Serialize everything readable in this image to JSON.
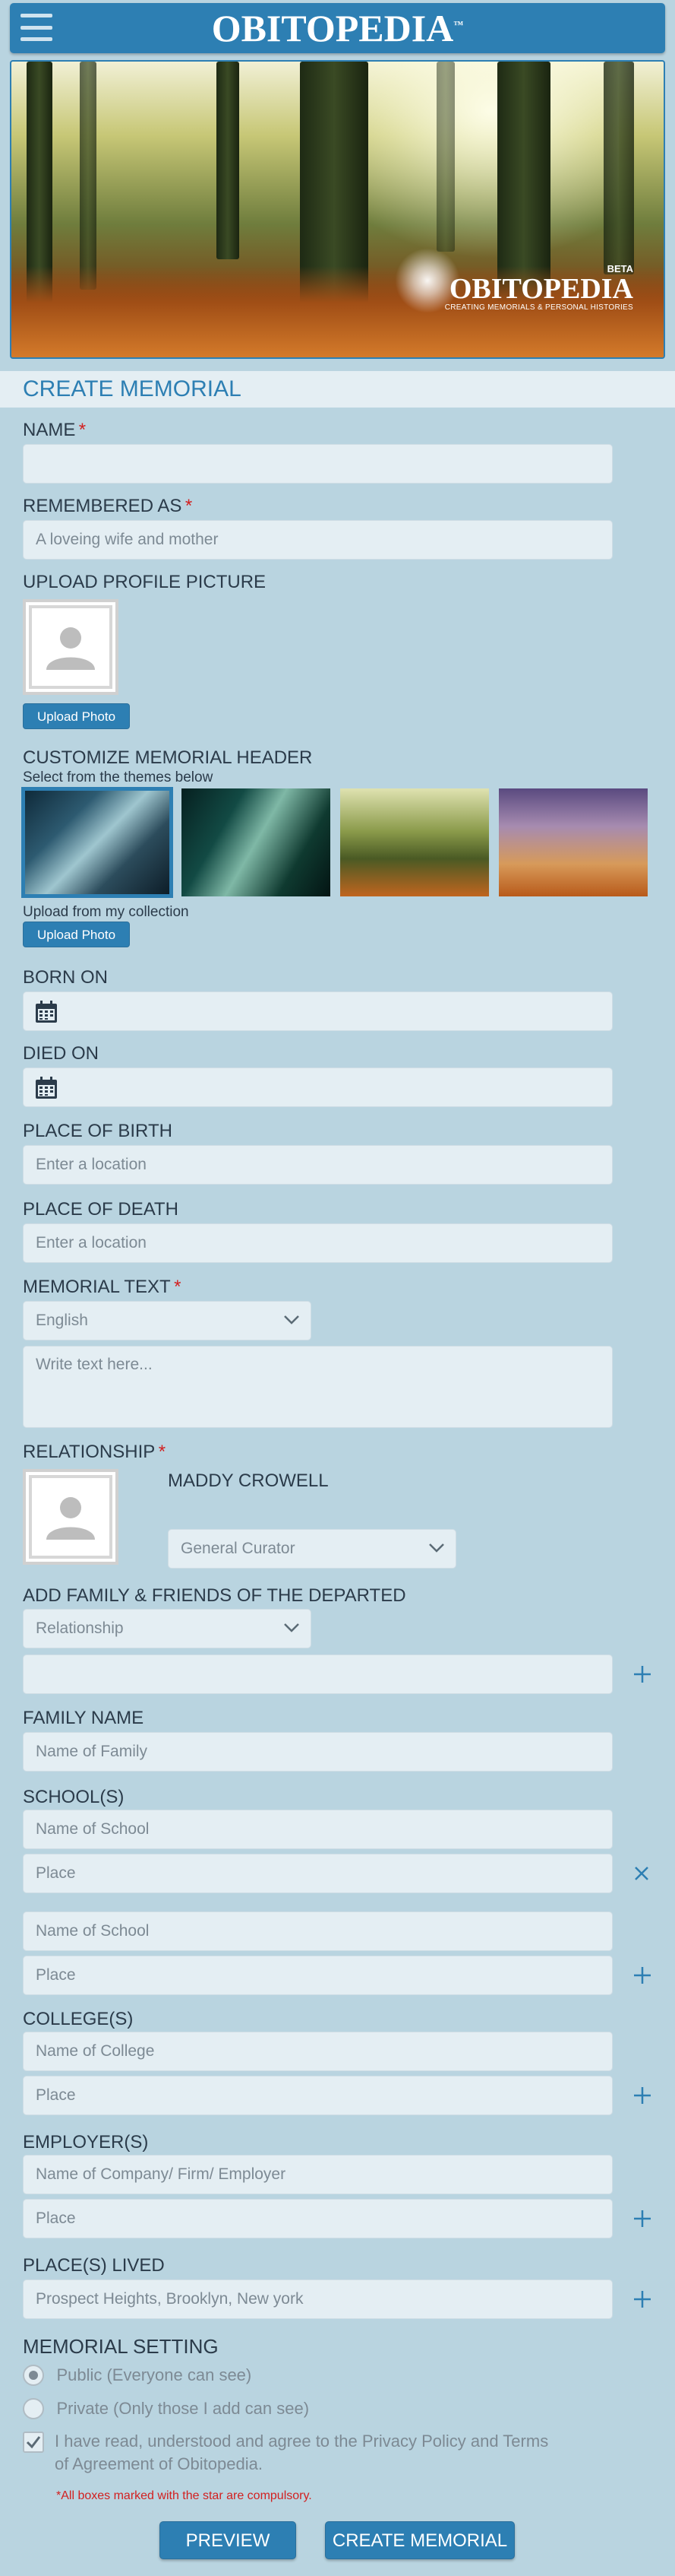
{
  "header": {
    "logo_text": "OBITOPEDIA",
    "logo_tm": "™",
    "menu_icon": "hamburger-menu-icon"
  },
  "hero": {
    "beta": "BETA",
    "brand": "OBITOPEDIA",
    "tagline": "CREATING MEMORIALS & PERSONAL HISTORIES"
  },
  "page_title": "CREATE MEMORIAL",
  "fields": {
    "name": {
      "label": "NAME",
      "required": "*",
      "value": ""
    },
    "remembered_as": {
      "label": "REMEMBERED AS",
      "required": "*",
      "placeholder": "A loveing wife and mother"
    },
    "upload_profile": {
      "label": "UPLOAD PROFILE PICTURE",
      "button": "Upload Photo"
    },
    "header_theme": {
      "label": "CUSTOMIZE MEMORIAL HEADER",
      "hint": "Select from the themes below",
      "collection_hint": "Upload from my collection",
      "button": "Upload Photo"
    },
    "born_on": {
      "label": "BORN ON"
    },
    "died_on": {
      "label": "DIED ON"
    },
    "place_of_birth": {
      "label": "PLACE OF BIRTH",
      "placeholder": "Enter a location"
    },
    "place_of_death": {
      "label": "PLACE OF DEATH",
      "placeholder": "Enter a location"
    },
    "memorial_text": {
      "label": "MEMORIAL TEXT",
      "required": "*",
      "language": "English",
      "placeholder": "Write text here..."
    },
    "relationship": {
      "label": "RELATIONSHIP",
      "required": "*",
      "person": "MADDY CROWELL",
      "role": "General Curator"
    },
    "family_friends": {
      "label": "ADD FAMILY & FRIENDS OF THE DEPARTED",
      "select": "Relationship"
    },
    "family_name": {
      "label": "FAMILY NAME",
      "placeholder": "Name of Family"
    },
    "schools": {
      "label": "SCHOOL(S)",
      "name_placeholder": "Name of School",
      "place_placeholder": "Place"
    },
    "colleges": {
      "label": "COLLEGE(S)",
      "name_placeholder": "Name of College",
      "place_placeholder": "Place"
    },
    "employers": {
      "label": "EMPLOYER(S)",
      "name_placeholder": "Name of Company/ Firm/ Employer",
      "place_placeholder": "Place"
    },
    "places_lived": {
      "label": "PLACE(S) LIVED",
      "value": "Prospect Heights, Brooklyn, New york"
    }
  },
  "memorial_setting": {
    "label": "MEMORIAL SETTING",
    "options": [
      {
        "label": "Public (Everyone can see)",
        "selected": true
      },
      {
        "label": "Private (Only those I add can see)",
        "selected": false
      }
    ],
    "agree_text_line1": "I have read, understood and agree to the Privacy Policy and Terms",
    "agree_text_line2": "of Agreement of Obitopedia.",
    "agree_checked": true,
    "note": "*All boxes marked with the star are compulsory."
  },
  "actions": {
    "preview": "PREVIEW",
    "create": "CREATE MEMORIAL"
  },
  "colors": {
    "brand_blue": "#2d7fb3",
    "background": "#b9d4e0",
    "input_bg": "#e4eef3",
    "required_red": "#d22020"
  }
}
